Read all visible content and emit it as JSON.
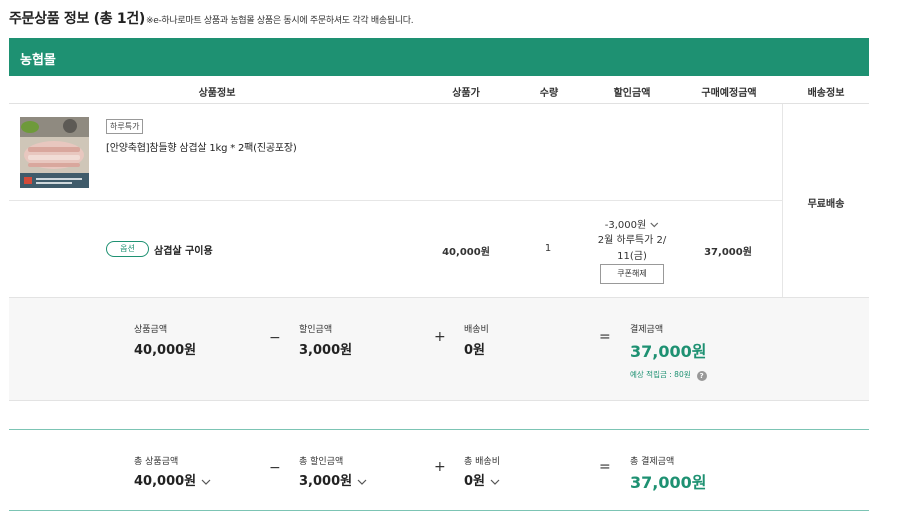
{
  "page": {
    "title": "주문상품 정보 (총 1건)",
    "note": "※e-하나로마트 상품과 농협몰 상품은 동시에 주문하셔도 각각 배송됩니다."
  },
  "mall": {
    "name": "농협몰"
  },
  "table": {
    "headers": {
      "product_info": "상품정보",
      "price": "상품가",
      "quantity": "수량",
      "discount": "할인금액",
      "expected_amount": "구매예정금액",
      "shipping_info": "배송정보"
    }
  },
  "item": {
    "badge": "하루특가",
    "name": "[안양축협]참들향 삼겹살 1kg * 2팩(진공포장)",
    "option_badge": "옵션",
    "option_name": "삼겹살 구이용",
    "price": "40,000원",
    "quantity": "1",
    "discount_amount": "-3,000원",
    "discount_desc": "2월 하루특가 2/ 11(금)",
    "coupon_button": "쿠폰해제",
    "expected_amount": "37,000원",
    "shipping": "무료배송"
  },
  "summary": {
    "product_label": "상품금액",
    "product_value": "40,000원",
    "discount_label": "할인금액",
    "discount_value": "3,000원",
    "shipping_label": "배송비",
    "shipping_value": "0원",
    "payment_label": "결제금액",
    "payment_value": "37,000원",
    "points": "예상 적립금 : 80원",
    "ops": {
      "minus": "−",
      "plus": "+",
      "equals": "="
    }
  },
  "total": {
    "product_label": "총 상품금액",
    "product_value": "40,000원",
    "discount_label": "총 할인금액",
    "discount_value": "3,000원",
    "shipping_label": "총 배송비",
    "shipping_value": "0원",
    "payment_label": "총 결제금액",
    "payment_value": "37,000원"
  },
  "icons": {
    "chevron": "chevron-down-icon",
    "help": "question-icon"
  },
  "colors": {
    "brand_green": "#1e9172",
    "divider_teal": "#7cc4b4",
    "summary_bg": "#f7f7f7"
  }
}
